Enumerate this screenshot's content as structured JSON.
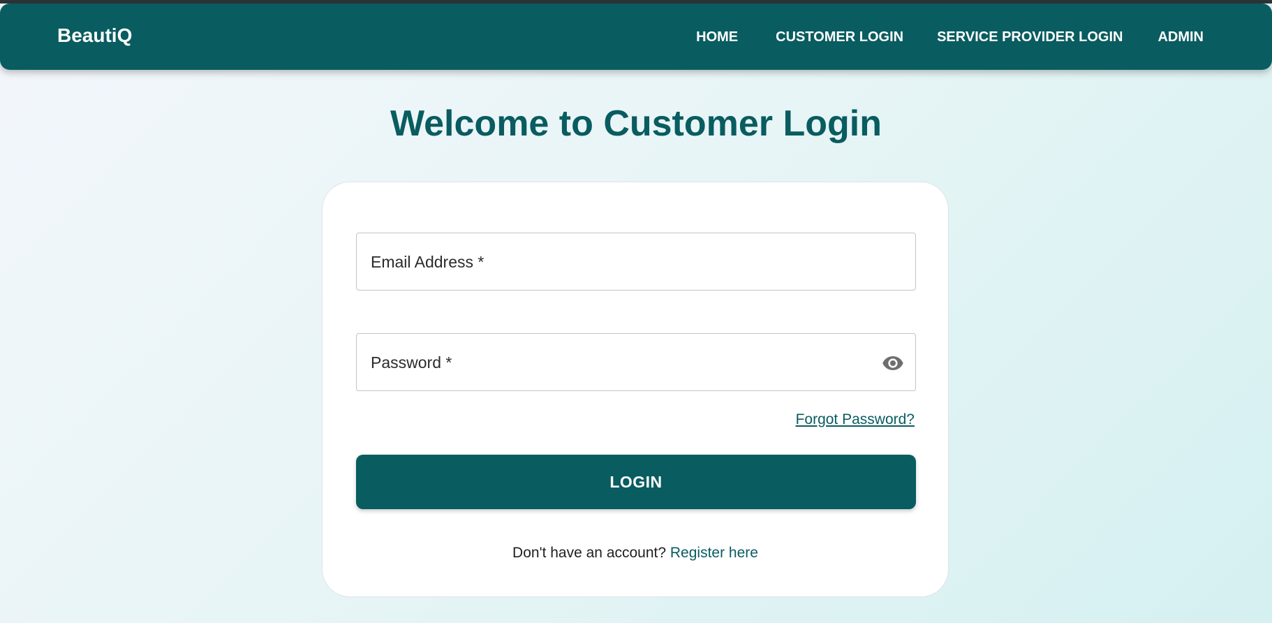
{
  "brand": "BeautiQ",
  "nav": {
    "home": "HOME",
    "customer_login": "CUSTOMER LOGIN",
    "service_provider_login": "SERVICE PROVIDER LOGIN",
    "admin": "ADMIN"
  },
  "page": {
    "title": "Welcome to Customer Login"
  },
  "form": {
    "email_label": "Email Address *",
    "email_value": "",
    "password_label": "Password *",
    "password_value": "",
    "forgot_password": "Forgot Password?",
    "login_button": "LOGIN",
    "register_prompt": "Don't have an account?",
    "register_link": "Register here"
  },
  "icons": {
    "password_toggle": "eye-icon"
  },
  "colors": {
    "primary": "#095c60",
    "background_start": "#f3f6fc",
    "background_end": "#d5f0f1"
  }
}
